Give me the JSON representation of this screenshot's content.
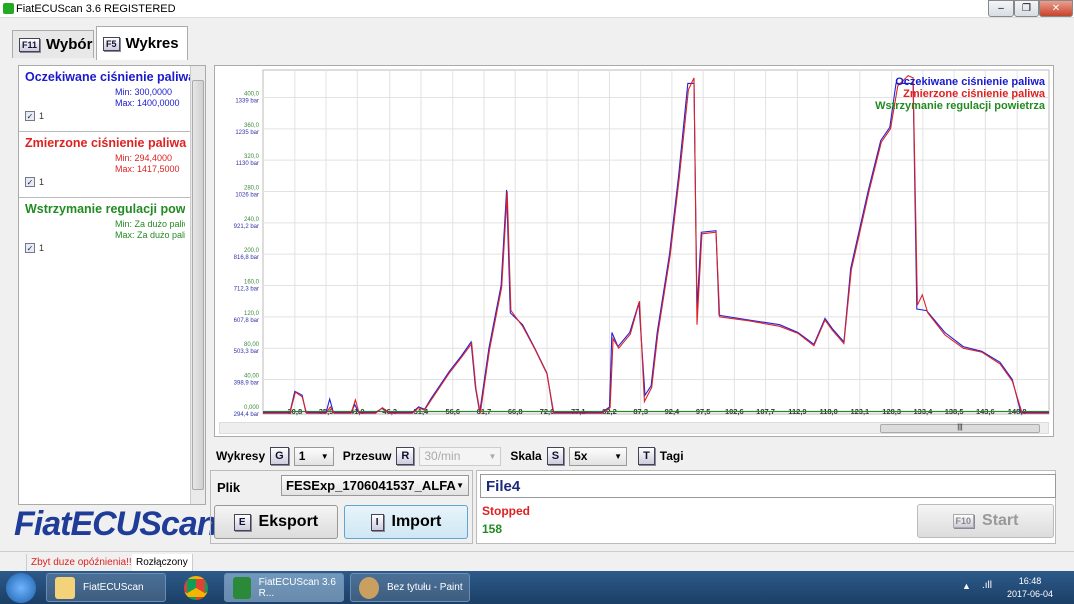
{
  "window": {
    "title": "FiatECUScan 3.6 REGISTERED"
  },
  "tabs": [
    {
      "key": "F11",
      "label": "Wybór"
    },
    {
      "key": "F5",
      "label": "Wykres"
    }
  ],
  "signals": [
    {
      "name": "Oczekiwane ciśnienie paliwa",
      "min": "Min: 300,0000",
      "max": "Max: 1400,0000",
      "checkbox_label": "1",
      "checked": true,
      "color": "#1a1acc"
    },
    {
      "name": "Zmierzone ciśnienie paliwa",
      "min": "Min: 294,4000",
      "max": "Max: 1417,5000",
      "checkbox_label": "1",
      "checked": true,
      "color": "#dd2222"
    },
    {
      "name": "Wstrzymanie regulacji powietrza",
      "name_visible": "Wstrzymanie regulacji powietr",
      "min": "Min: Za dużo paliw",
      "max": "Max: Za dużo paliv",
      "checkbox_label": "1",
      "checked": true,
      "color": "#228b22"
    }
  ],
  "logo": "FiatECUScan",
  "controls": {
    "wykresy_label": "Wykresy",
    "wykresy_key": "G",
    "wykresy_value": "1",
    "przesuw_label": "Przesuw",
    "przesuw_key": "R",
    "przesuw_value": "30/min",
    "skala_label": "Skala",
    "skala_key": "S",
    "skala_value": "5x",
    "tagi_key": "T",
    "tagi_label": "Tagi"
  },
  "file": {
    "label": "Plik",
    "value": "FESExp_1706041537_ALFA",
    "export_key": "E",
    "export_label": "Eksport",
    "import_key": "I",
    "import_label": "Import"
  },
  "status": {
    "filename": "File4",
    "state": "Stopped",
    "count": "158",
    "start_key": "F10",
    "start_label": "Start"
  },
  "statusbar": {
    "warning": "Zbyt duze opóźnienia!!!",
    "connection": "Rozłączony"
  },
  "taskbar": {
    "items": [
      "FiatECUScan",
      "FiatECUScan 3.6 R...",
      "Bez tytułu - Paint"
    ],
    "time": "16:48",
    "date": "2017-06-04"
  },
  "chart_data": {
    "type": "line",
    "xlim": [
      25.6,
      154
    ],
    "ylim": [
      -4,
      430
    ],
    "x_ticks": [
      "30,8",
      "35,9",
      "41,0",
      "46,3",
      "51,4",
      "56,6",
      "61,7",
      "66,8",
      "72,0",
      "77,1",
      "82,2",
      "87,3",
      "92,4",
      "97,5",
      "102,6",
      "107,7",
      "112,9",
      "118,0",
      "123,1",
      "128,3",
      "133,4",
      "138,5",
      "143,6",
      "148,8"
    ],
    "x_tick_values": [
      30.8,
      35.9,
      41.0,
      46.3,
      51.4,
      56.6,
      61.7,
      66.8,
      72.0,
      77.1,
      82.2,
      87.3,
      92.4,
      97.5,
      102.6,
      107.7,
      112.9,
      118.0,
      123.1,
      128.3,
      133.4,
      138.5,
      143.6,
      148.8
    ],
    "y_ticks": [
      {
        "v": 0,
        "a": "0,000",
        "b": "294,4 bar"
      },
      {
        "v": 40,
        "a": "40,00",
        "b": "398,9 bar"
      },
      {
        "v": 80,
        "a": "80,00",
        "b": "503,3 bar"
      },
      {
        "v": 120,
        "a": "120,0",
        "b": "607,8 bar"
      },
      {
        "v": 160,
        "a": "160,0",
        "b": "712,3 bar"
      },
      {
        "v": 200,
        "a": "200,0",
        "b": "816,8 bar"
      },
      {
        "v": 240,
        "a": "240,0",
        "b": "921,2 bar"
      },
      {
        "v": 280,
        "a": "280,0",
        "b": "1026 bar"
      },
      {
        "v": 320,
        "a": "320,0",
        "b": "1130 bar"
      },
      {
        "v": 360,
        "a": "360,0",
        "b": "1235 bar"
      },
      {
        "v": 400,
        "a": "400,0",
        "b": "1339 bar"
      }
    ],
    "legend_position": "top-right",
    "series": [
      {
        "name": "Oczekiwane ciśnienie paliwa",
        "color": "#2222dd",
        "points": [
          [
            25.6,
            -2
          ],
          [
            30,
            -2
          ],
          [
            30.8,
            25
          ],
          [
            32,
            20
          ],
          [
            32.6,
            -2
          ],
          [
            35.9,
            -2
          ],
          [
            36.5,
            15
          ],
          [
            37.1,
            -2
          ],
          [
            40,
            -2
          ],
          [
            40.6,
            8
          ],
          [
            41.2,
            -2
          ],
          [
            44,
            -2
          ],
          [
            45,
            3
          ],
          [
            46.3,
            -2
          ],
          [
            50,
            -2
          ],
          [
            51,
            5
          ],
          [
            52,
            2
          ],
          [
            53,
            15
          ],
          [
            56,
            50
          ],
          [
            58,
            70
          ],
          [
            59.6,
            88
          ],
          [
            60.3,
            30
          ],
          [
            61,
            -2
          ],
          [
            62.5,
            80
          ],
          [
            64.5,
            160
          ],
          [
            65.4,
            282
          ],
          [
            66,
            125
          ],
          [
            68,
            110
          ],
          [
            70,
            80
          ],
          [
            72,
            48
          ],
          [
            73,
            -2
          ],
          [
            81,
            -2
          ],
          [
            82.2,
            5
          ],
          [
            82.6,
            100
          ],
          [
            83.6,
            82
          ],
          [
            85.5,
            100
          ],
          [
            87,
            138
          ],
          [
            88,
            20
          ],
          [
            89,
            32
          ],
          [
            90,
            100
          ],
          [
            92,
            200
          ],
          [
            93.5,
            300
          ],
          [
            95,
            418
          ],
          [
            96,
            418
          ],
          [
            96.5,
            130
          ],
          [
            97.2,
            228
          ],
          [
            99.6,
            230
          ],
          [
            100.1,
            122
          ],
          [
            105,
            116
          ],
          [
            110,
            110
          ],
          [
            113,
            100
          ],
          [
            115.6,
            85
          ],
          [
            117.4,
            118
          ],
          [
            118.6,
            105
          ],
          [
            120.5,
            88
          ],
          [
            121.6,
            182
          ],
          [
            124.5,
            282
          ],
          [
            126.5,
            345
          ],
          [
            128,
            362
          ],
          [
            129,
            418
          ],
          [
            131.8,
            418
          ],
          [
            132.4,
            130
          ],
          [
            134,
            128
          ],
          [
            137,
            100
          ],
          [
            140,
            82
          ],
          [
            143,
            76
          ],
          [
            146,
            62
          ],
          [
            148,
            40
          ],
          [
            149.4,
            -2
          ],
          [
            154,
            -2
          ]
        ]
      },
      {
        "name": "Zmierzone ciśnienie paliwa",
        "color": "#dd2222",
        "points": [
          [
            25.6,
            -3
          ],
          [
            30,
            -3
          ],
          [
            30.9,
            24
          ],
          [
            32,
            18
          ],
          [
            32.7,
            -3
          ],
          [
            35.9,
            -3
          ],
          [
            36.6,
            5
          ],
          [
            37.2,
            -3
          ],
          [
            40,
            -3
          ],
          [
            40.7,
            14
          ],
          [
            41.3,
            -3
          ],
          [
            44,
            -3
          ],
          [
            45.1,
            4
          ],
          [
            46.3,
            -3
          ],
          [
            50,
            -3
          ],
          [
            51,
            4
          ],
          [
            52,
            1
          ],
          [
            53,
            13
          ],
          [
            56,
            48
          ],
          [
            58,
            68
          ],
          [
            59.7,
            86
          ],
          [
            60.4,
            28
          ],
          [
            61.1,
            -3
          ],
          [
            62.6,
            78
          ],
          [
            64.6,
            158
          ],
          [
            65.5,
            280
          ],
          [
            66.1,
            128
          ],
          [
            68,
            108
          ],
          [
            70,
            79
          ],
          [
            72,
            47
          ],
          [
            73.1,
            -3
          ],
          [
            81,
            -3
          ],
          [
            82.3,
            4
          ],
          [
            82.8,
            92
          ],
          [
            83.7,
            80
          ],
          [
            85.6,
            98
          ],
          [
            87.1,
            140
          ],
          [
            87.9,
            12
          ],
          [
            89.1,
            30
          ],
          [
            90.1,
            98
          ],
          [
            92.1,
            198
          ],
          [
            93.6,
            298
          ],
          [
            95.1,
            410
          ],
          [
            96,
            425
          ],
          [
            96.5,
            110
          ],
          [
            97.3,
            226
          ],
          [
            99.6,
            228
          ],
          [
            100.2,
            120
          ],
          [
            105,
            115
          ],
          [
            110,
            108
          ],
          [
            113,
            99
          ],
          [
            115.6,
            83
          ],
          [
            117.4,
            116
          ],
          [
            118.6,
            103
          ],
          [
            120.5,
            86
          ],
          [
            121.7,
            180
          ],
          [
            124.6,
            280
          ],
          [
            126.6,
            343
          ],
          [
            128.1,
            360
          ],
          [
            129.3,
            415
          ],
          [
            131,
            428
          ],
          [
            131.8,
            425
          ],
          [
            132.5,
            135
          ],
          [
            133.3,
            148
          ],
          [
            134.2,
            125
          ],
          [
            137,
            97
          ],
          [
            140,
            80
          ],
          [
            143,
            75
          ],
          [
            146,
            60
          ],
          [
            148,
            38
          ],
          [
            149.6,
            -3
          ],
          [
            154,
            -3
          ]
        ]
      },
      {
        "name": "Wstrzymanie regulacji powietrza",
        "color": "#228b22",
        "points": [
          [
            25.6,
            -1
          ],
          [
            154,
            -1
          ]
        ]
      }
    ]
  }
}
